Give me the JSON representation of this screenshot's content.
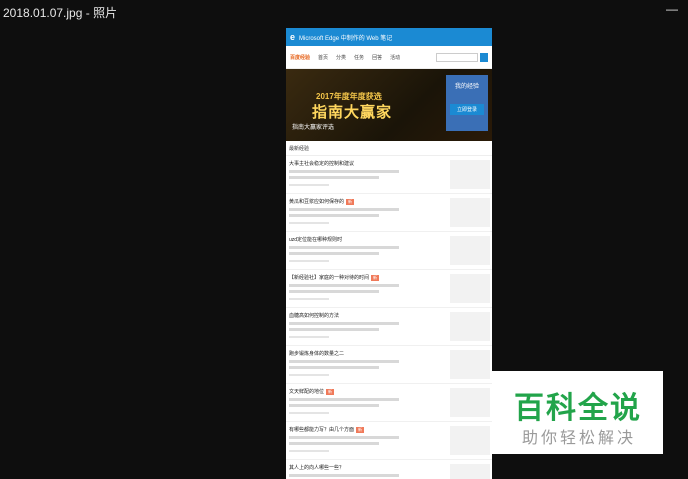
{
  "window": {
    "title": "2018.01.07.jpg - 照片",
    "minimize": "—"
  },
  "photo": {
    "edge_title": "Microsoft Edge 中制作的 Web 笔记",
    "logo": "百度经验",
    "nav": [
      "首页",
      "分类",
      "任务",
      "回答",
      "活动"
    ],
    "banner": {
      "line1": "2017年度年度获选",
      "line2": "指南大赢家",
      "caption": "指南大赢家评选",
      "side_title": "我的经验",
      "side_button": "立即登录"
    },
    "tabs_label": "最新经验",
    "items": [
      {
        "title": "大事主社会稳定的控制和建议",
        "tag": ""
      },
      {
        "title": "黄瓜和豆浆应如何保存的",
        "tag": "新"
      },
      {
        "title": "uzd定位能在哪种规则时",
        "tag": ""
      },
      {
        "title": "【新经验社】家庭的一种对待的时间",
        "tag": "新"
      },
      {
        "title": "血糖高如何控制的方法",
        "tag": ""
      },
      {
        "title": "跑步锻炼身体的数量之二",
        "tag": ""
      },
      {
        "title": "文天鲜配的地位",
        "tag": "新"
      },
      {
        "title": "有哪些都能力写？由几个方面",
        "tag": "新"
      },
      {
        "title": "其人上的向人哪些一些？",
        "tag": ""
      }
    ]
  },
  "watermark": {
    "big": "百科全说",
    "small": "助你轻松解决"
  }
}
